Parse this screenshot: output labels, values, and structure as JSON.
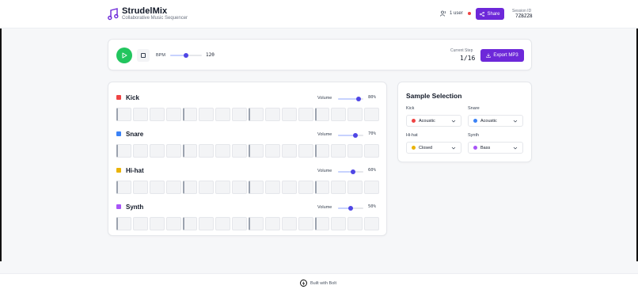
{
  "header": {
    "title": "StrudelMix",
    "subtitle": "Collaborative Music Sequencer",
    "users_label": "1 user",
    "share_label": "Share",
    "session_label": "Session ID",
    "session_id": "7ZBZZ8",
    "icons": [
      "music-note-icon",
      "users-icon",
      "share-icon"
    ]
  },
  "transport": {
    "bpm_label": "BPM",
    "bpm_value": "120",
    "bpm_level": 0.5,
    "current_step_label": "Current Step",
    "current_step": "1/16",
    "export_label": "Export MP3",
    "icons": [
      "play-icon",
      "stop-icon",
      "download-icon"
    ]
  },
  "tracks": [
    {
      "name": "Kick",
      "color": "#ef4444",
      "volume_label": "Volume",
      "volume": "80%",
      "level": 0.8,
      "steps": 16
    },
    {
      "name": "Snare",
      "color": "#3b82f6",
      "volume_label": "Volume",
      "volume": "70%",
      "level": 0.7,
      "steps": 16
    },
    {
      "name": "Hi-hat",
      "color": "#eab308",
      "volume_label": "Volume",
      "volume": "60%",
      "level": 0.6,
      "steps": 16
    },
    {
      "name": "Synth",
      "color": "#a855f7",
      "volume_label": "Volume",
      "volume": "50%",
      "level": 0.5,
      "steps": 16
    }
  ],
  "samples": {
    "title": "Sample Selection",
    "items": [
      {
        "label": "Kick",
        "value": "Acoustic",
        "color": "#ef4444"
      },
      {
        "label": "Snare",
        "value": "Acoustic",
        "color": "#3b82f6"
      },
      {
        "label": "Hi-hat",
        "value": "Closed",
        "color": "#eab308"
      },
      {
        "label": "Synth",
        "value": "Bass",
        "color": "#a855f7"
      }
    ]
  },
  "footer": {
    "text": "Built with Bolt"
  },
  "colors": {
    "accent": "#6d28d9",
    "play": "#22c55e",
    "slider_thumb": "#4f46e5"
  }
}
